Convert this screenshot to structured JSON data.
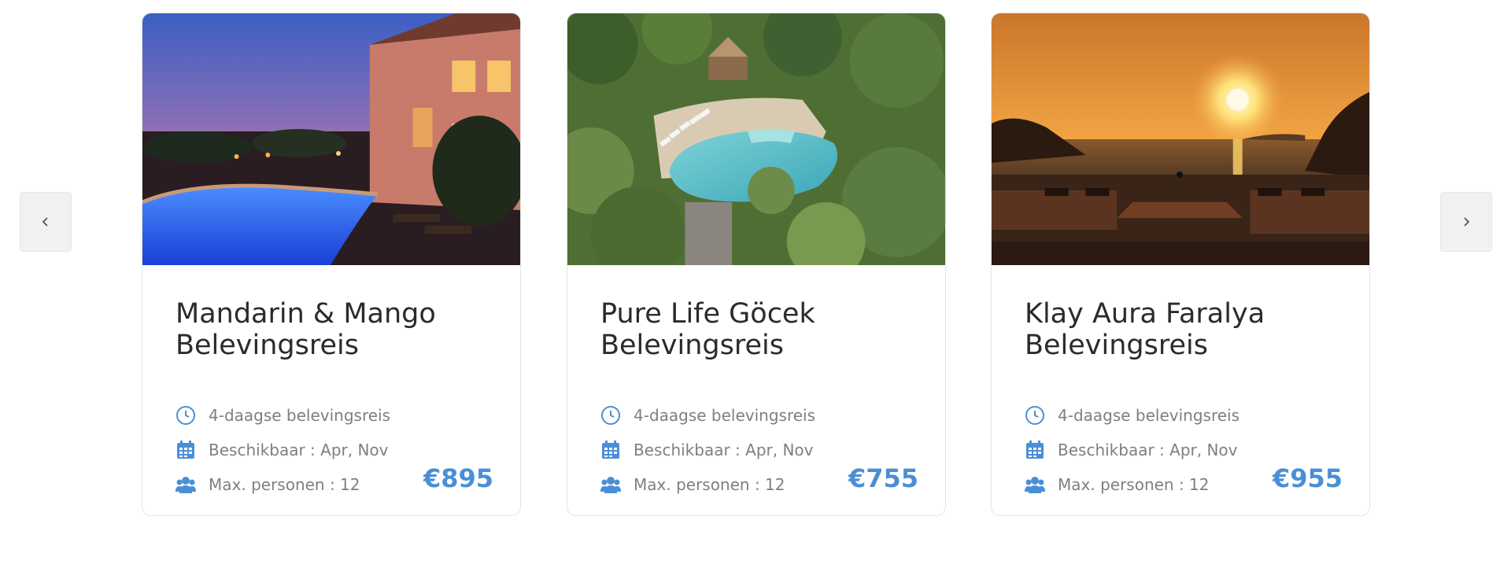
{
  "carousel": {
    "prev_icon": "chevron-left-icon",
    "next_icon": "chevron-right-icon"
  },
  "accent_color": "#4a8fd6",
  "cards": [
    {
      "title_line1": "Mandarin & Mango",
      "title_line2": "Belevingsreis",
      "duration": "4-daagse belevingsreis",
      "availability": "Beschikbaar : Apr, Nov",
      "max_persons": "Max. personen : 12",
      "price": "€895",
      "image": "villa-pool-at-dusk"
    },
    {
      "title_line1": "Pure Life Göcek",
      "title_line2": "Belevingsreis",
      "duration": "4-daagse belevingsreis",
      "availability": "Beschikbaar : Apr, Nov",
      "max_persons": "Max. personen : 12",
      "price": "€755",
      "image": "aerial-pool-olive-trees"
    },
    {
      "title_line1": "Klay Aura Faralya",
      "title_line2": "Belevingsreis",
      "duration": "4-daagse belevingsreis",
      "availability": "Beschikbaar : Apr, Nov",
      "max_persons": "Max. personen : 12",
      "price": "€955",
      "image": "infinity-pool-sunset"
    }
  ]
}
